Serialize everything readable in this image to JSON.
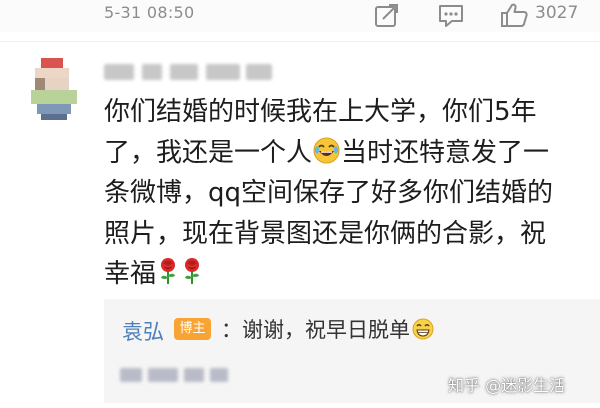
{
  "header": {
    "timestamp": "5-31 08:50",
    "like_count": "3027",
    "actions": [
      "share-icon",
      "comment-icon",
      "thumbs-up-icon"
    ]
  },
  "comment": {
    "lines": [
      "你们结婚的时候我在上大学，你们5年",
      "了，我还是一个人",
      "当时还特意发了一",
      "条微博，qq空间保存了好多你们结婚的",
      "照片，现在背景图还是你俩的合影，祝",
      "幸福"
    ],
    "emojis": [
      "laugh-cry-emoji",
      "rose-emoji"
    ]
  },
  "reply": {
    "author": "袁弘",
    "badge": "博主",
    "text": "：谢谢，祝早日脱单"
  },
  "watermark": "知乎 @迷影生活",
  "colors": {
    "reply_author": "#4d7fb8",
    "badge": "#f7a435",
    "reply_bg": "#f5f5f5"
  }
}
